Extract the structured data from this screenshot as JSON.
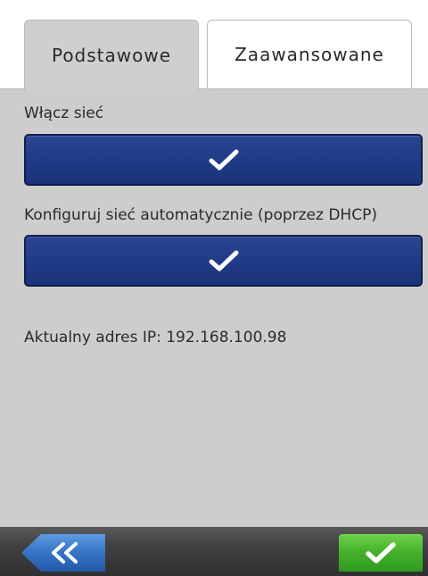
{
  "tabs": {
    "basic": "Podstawowe",
    "advanced": "Zaawansowane"
  },
  "settings": {
    "enable_network_label": "Włącz sieć",
    "enable_network_checked": true,
    "dhcp_label": "Konfiguruj sieć automatycznie (poprzez DHCP)",
    "dhcp_checked": true,
    "ip_text": "Aktualny adres IP: 192.168.100.98"
  },
  "footer": {
    "back_icon": "double-chevron-left-icon",
    "confirm_icon": "checkmark-icon"
  },
  "colors": {
    "toggle_blue": "#1f3a86",
    "panel_gray": "#cdcdcd",
    "confirm_green": "#43b02a",
    "back_blue": "#2f6fc0"
  }
}
